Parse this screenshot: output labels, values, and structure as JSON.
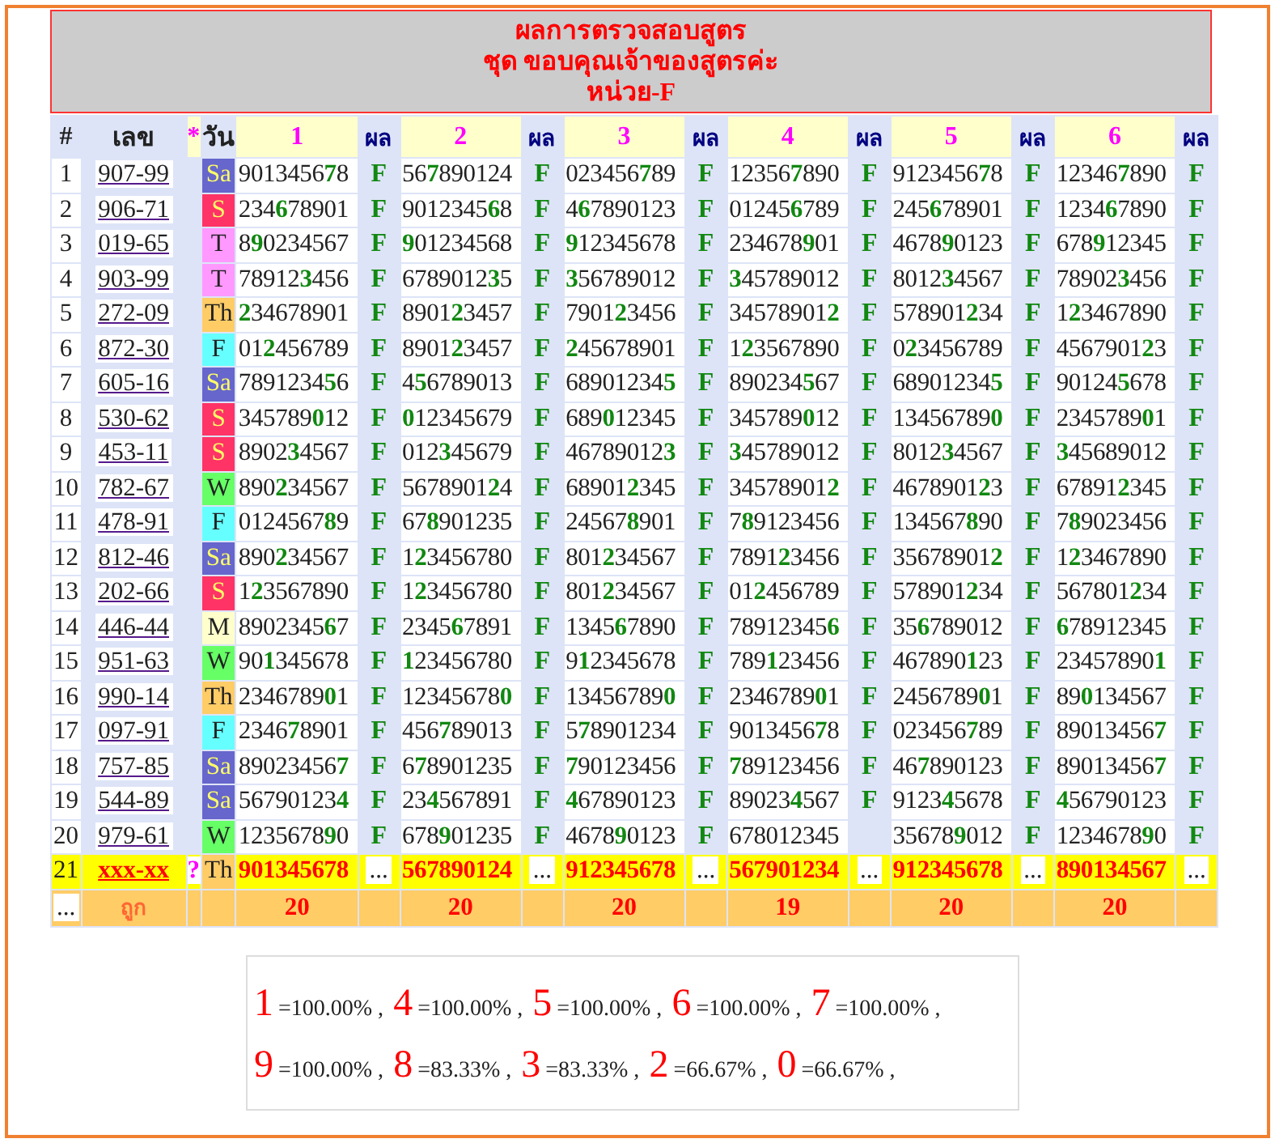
{
  "title": {
    "lines": [
      "ผลการตรวจสอบสูตร",
      "ชุด ขอบคุณเจ้าของสูตรค่ะ",
      "หน่วย-F"
    ]
  },
  "table": {
    "header": {
      "index": "#",
      "code": "เลข",
      "mark": "*",
      "day": "วัน",
      "sets": [
        {
          "label": "1",
          "result_label": "ผล"
        },
        {
          "label": "2",
          "result_label": "ผล"
        },
        {
          "label": "3",
          "result_label": "ผล"
        },
        {
          "label": "4",
          "result_label": "ผล"
        },
        {
          "label": "5",
          "result_label": "ผล"
        },
        {
          "label": "6",
          "result_label": "ผล"
        }
      ]
    },
    "rows": [
      {
        "kind": "result",
        "no": "1",
        "code": "907-99",
        "day": "Sa",
        "color": "#6666cc",
        "cells": [
          {
            "number": "9013456**7**8",
            "result": "F"
          },
          {
            "number": "56**7**890124",
            "result": "F"
          },
          {
            "number": "023456**7**89",
            "result": "F"
          },
          {
            "number": "12356**7**890",
            "result": "F"
          },
          {
            "number": "9123456**7**8",
            "result": "F"
          },
          {
            "number": "12346**7**890",
            "result": "F"
          }
        ]
      },
      {
        "kind": "result",
        "no": "2",
        "code": "906-71",
        "day": "S",
        "color": "#ff3366",
        "cells": [
          {
            "number": "234**6**78901",
            "result": "F"
          },
          {
            "number": "9012345**6**8",
            "result": "F"
          },
          {
            "number": "4**6**7890123",
            "result": "F"
          },
          {
            "number": "01245**6**789",
            "result": "F"
          },
          {
            "number": "245**6**78901",
            "result": "F"
          },
          {
            "number": "1234**6**7890",
            "result": "F"
          }
        ]
      },
      {
        "kind": "result",
        "no": "3",
        "code": "019-65",
        "day": "T",
        "color": "#ff99ff",
        "cells": [
          {
            "number": "8**9**0234567",
            "result": "F"
          },
          {
            "number": "**9**01234568",
            "result": "F"
          },
          {
            "number": "**9**12345678",
            "result": "F"
          },
          {
            "number": "234678**9**01",
            "result": "F"
          },
          {
            "number": "4678**9**0123",
            "result": "F"
          },
          {
            "number": "678**9**12345",
            "result": "F"
          }
        ]
      },
      {
        "kind": "result",
        "no": "4",
        "code": "903-99",
        "day": "T",
        "color": "#ff99ff",
        "cells": [
          {
            "number": "78912**3**456",
            "result": "F"
          },
          {
            "number": "6789012**3**5",
            "result": "F"
          },
          {
            "number": "**3**56789012",
            "result": "F"
          },
          {
            "number": "**3**45789012",
            "result": "F"
          },
          {
            "number": "8012**3**4567",
            "result": "F"
          },
          {
            "number": "78902**3**456",
            "result": "F"
          }
        ]
      },
      {
        "kind": "result",
        "no": "5",
        "code": "272-09",
        "day": "Th",
        "color": "#ffcc66",
        "cells": [
          {
            "number": "**2**34678901",
            "result": "F"
          },
          {
            "number": "8901**2**3457",
            "result": "F"
          },
          {
            "number": "7901**2**3456",
            "result": "F"
          },
          {
            "number": "34578901**2**",
            "result": "F"
          },
          {
            "number": "578901**2**34",
            "result": "F"
          },
          {
            "number": "1**2**3467890",
            "result": "F"
          }
        ]
      },
      {
        "kind": "result",
        "no": "6",
        "code": "872-30",
        "day": "F",
        "color": "#66ffff",
        "cells": [
          {
            "number": "01**2**456789",
            "result": "F"
          },
          {
            "number": "8901**2**3457",
            "result": "F"
          },
          {
            "number": "**2**45678901",
            "result": "F"
          },
          {
            "number": "1**2**3567890",
            "result": "F"
          },
          {
            "number": "0**2**3456789",
            "result": "F"
          },
          {
            "number": "4567901**2**3",
            "result": "F"
          }
        ]
      },
      {
        "kind": "result",
        "no": "7",
        "code": "605-16",
        "day": "Sa",
        "color": "#6666cc",
        "cells": [
          {
            "number": "7891234**5**6",
            "result": "F"
          },
          {
            "number": "4**5**6789013",
            "result": "F"
          },
          {
            "number": "68901234**5**",
            "result": "F"
          },
          {
            "number": "890234**5**67",
            "result": "F"
          },
          {
            "number": "68901234**5**",
            "result": "F"
          },
          {
            "number": "90124**5**678",
            "result": "F"
          }
        ]
      },
      {
        "kind": "result",
        "no": "8",
        "code": "530-62",
        "day": "S",
        "color": "#ff3366",
        "cells": [
          {
            "number": "345789**0**12",
            "result": "F"
          },
          {
            "number": "**0**12345679",
            "result": "F"
          },
          {
            "number": "689**0**12345",
            "result": "F"
          },
          {
            "number": "345789**0**12",
            "result": "F"
          },
          {
            "number": "13456789**0**",
            "result": "F"
          },
          {
            "number": "2345789**0**1",
            "result": "F"
          }
        ]
      },
      {
        "kind": "result",
        "no": "9",
        "code": "453-11",
        "day": "S",
        "color": "#ff3366",
        "cells": [
          {
            "number": "8902**3**4567",
            "result": "F"
          },
          {
            "number": "012**3**45679",
            "result": "F"
          },
          {
            "number": "46789012**3**",
            "result": "F"
          },
          {
            "number": "**3**45789012",
            "result": "F"
          },
          {
            "number": "8012**3**4567",
            "result": "F"
          },
          {
            "number": "**3**45689012",
            "result": "F"
          }
        ]
      },
      {
        "kind": "result",
        "no": "10",
        "code": "782-67",
        "day": "W",
        "color": "#66ff66",
        "cells": [
          {
            "number": "890**2**34567",
            "result": "F"
          },
          {
            "number": "5678901**2**4",
            "result": "F"
          },
          {
            "number": "68901**2**345",
            "result": "F"
          },
          {
            "number": "34578901**2**",
            "result": "F"
          },
          {
            "number": "4678901**2**3",
            "result": "F"
          },
          {
            "number": "67891**2**345",
            "result": "F"
          }
        ]
      },
      {
        "kind": "result",
        "no": "11",
        "code": "478-91",
        "day": "F",
        "color": "#66ffff",
        "cells": [
          {
            "number": "0124567**8**9",
            "result": "F"
          },
          {
            "number": "67**8**901235",
            "result": "F"
          },
          {
            "number": "24567**8**901",
            "result": "F"
          },
          {
            "number": "7**8**9123456",
            "result": "F"
          },
          {
            "number": "134567**8**90",
            "result": "F"
          },
          {
            "number": "7**8**9023456",
            "result": "F"
          }
        ]
      },
      {
        "kind": "result",
        "no": "12",
        "code": "812-46",
        "day": "Sa",
        "color": "#6666cc",
        "cells": [
          {
            "number": "890**2**34567",
            "result": "F"
          },
          {
            "number": "1**2**3456780",
            "result": "F"
          },
          {
            "number": "801**2**34567",
            "result": "F"
          },
          {
            "number": "7891**2**3456",
            "result": "F"
          },
          {
            "number": "35678901**2**",
            "result": "F"
          },
          {
            "number": "1**2**3467890",
            "result": "F"
          }
        ]
      },
      {
        "kind": "result",
        "no": "13",
        "code": "202-66",
        "day": "S",
        "color": "#ff3366",
        "cells": [
          {
            "number": "1**2**3567890",
            "result": "F"
          },
          {
            "number": "1**2**3456780",
            "result": "F"
          },
          {
            "number": "801**2**34567",
            "result": "F"
          },
          {
            "number": "01**2**456789",
            "result": "F"
          },
          {
            "number": "578901**2**34",
            "result": "F"
          },
          {
            "number": "567801**2**34",
            "result": "F"
          }
        ]
      },
      {
        "kind": "result",
        "no": "14",
        "code": "446-44",
        "day": "M",
        "color": "#ffffcc",
        "cells": [
          {
            "number": "8902345**6**7",
            "result": "F"
          },
          {
            "number": "2345**6**7891",
            "result": "F"
          },
          {
            "number": "1345**6**7890",
            "result": "F"
          },
          {
            "number": "78912345**6**",
            "result": "F"
          },
          {
            "number": "35**6**789012",
            "result": "F"
          },
          {
            "number": "**6**78912345",
            "result": "F"
          }
        ]
      },
      {
        "kind": "result",
        "no": "15",
        "code": "951-63",
        "day": "W",
        "color": "#66ff66",
        "cells": [
          {
            "number": "90**1**345678",
            "result": "F"
          },
          {
            "number": "**1**23456780",
            "result": "F"
          },
          {
            "number": "9**1**2345678",
            "result": "F"
          },
          {
            "number": "789**1**23456",
            "result": "F"
          },
          {
            "number": "467890**1**23",
            "result": "F"
          },
          {
            "number": "23457890**1**",
            "result": "F"
          }
        ]
      },
      {
        "kind": "result",
        "no": "16",
        "code": "990-14",
        "day": "Th",
        "color": "#ffcc66",
        "cells": [
          {
            "number": "2346789**0**1",
            "result": "F"
          },
          {
            "number": "12345678**0**",
            "result": "F"
          },
          {
            "number": "13456789**0**",
            "result": "F"
          },
          {
            "number": "2346789**0**1",
            "result": "F"
          },
          {
            "number": "2456789**0**1",
            "result": "F"
          },
          {
            "number": "89**0**134567",
            "result": "F"
          }
        ]
      },
      {
        "kind": "result",
        "no": "17",
        "code": "097-91",
        "day": "F",
        "color": "#66ffff",
        "cells": [
          {
            "number": "2346**7**8901",
            "result": "F"
          },
          {
            "number": "456**7**89013",
            "result": "F"
          },
          {
            "number": "5**7**8901234",
            "result": "F"
          },
          {
            "number": "9013456**7**8",
            "result": "F"
          },
          {
            "number": "023456**7**89",
            "result": "F"
          },
          {
            "number": "89013456**7**",
            "result": "F"
          }
        ]
      },
      {
        "kind": "result",
        "no": "18",
        "code": "757-85",
        "day": "Sa",
        "color": "#6666cc",
        "cells": [
          {
            "number": "89023456**7**",
            "result": "F"
          },
          {
            "number": "6**7**8901235",
            "result": "F"
          },
          {
            "number": "**7**90123456",
            "result": "F"
          },
          {
            "number": "**7**89123456",
            "result": "F"
          },
          {
            "number": "46**7**890123",
            "result": "F"
          },
          {
            "number": "89013456**7**",
            "result": "F"
          }
        ]
      },
      {
        "kind": "result",
        "no": "19",
        "code": "544-89",
        "day": "Sa",
        "color": "#6666cc",
        "cells": [
          {
            "number": "56790123**4**",
            "result": "F"
          },
          {
            "number": "23**4**567891",
            "result": "F"
          },
          {
            "number": "**4**67890123",
            "result": "F"
          },
          {
            "number": "89023**4**567",
            "result": "F"
          },
          {
            "number": "9123**4**5678",
            "result": "F"
          },
          {
            "number": "**4**56790123",
            "result": "F"
          }
        ]
      },
      {
        "kind": "result",
        "no": "20",
        "code": "979-61",
        "day": "W",
        "color": "#66ff66",
        "cells": [
          {
            "number": "1235678**9**0",
            "result": "F"
          },
          {
            "number": "678**9**01235",
            "result": "F"
          },
          {
            "number": "4678**9**0123",
            "result": "F"
          },
          {
            "number": "678012345"
          },
          {
            "number": "35678**9**012",
            "result": "F"
          },
          {
            "number": "1234678**9**0",
            "result": "F"
          }
        ]
      },
      {
        "kind": "prediction",
        "no": "21",
        "code": "xxx-xx",
        "mark": "?",
        "day": "Th",
        "color": "#ffcc66",
        "cells": [
          {
            "number": "901345678",
            "result": "..."
          },
          {
            "number": "567890124",
            "result": "..."
          },
          {
            "number": "912345678",
            "result": "..."
          },
          {
            "number": "567901234",
            "result": "..."
          },
          {
            "number": "912345678",
            "result": "..."
          },
          {
            "number": "890134567",
            "result": "..."
          }
        ]
      }
    ],
    "summary": {
      "index": "...",
      "label": "ถูก",
      "counts": [
        "20",
        "20",
        "20",
        "19",
        "20",
        "20"
      ]
    }
  },
  "stats": {
    "lines": [
      [
        {
          "digit": "1",
          "percent": "=100.00% ,"
        },
        {
          "digit": "4",
          "percent": "=100.00% ,"
        },
        {
          "digit": "5",
          "percent": "=100.00% ,"
        },
        {
          "digit": "6",
          "percent": "=100.00% ,"
        },
        {
          "digit": "7",
          "percent": "=100.00% ,"
        }
      ],
      [
        {
          "digit": "9",
          "percent": "=100.00% ,"
        },
        {
          "digit": "8",
          "percent": "=83.33% ,"
        },
        {
          "digit": "3",
          "percent": "=83.33% ,"
        },
        {
          "digit": "2",
          "percent": "=66.67% ,"
        },
        {
          "digit": "0",
          "percent": "=66.67% ,"
        }
      ]
    ]
  }
}
